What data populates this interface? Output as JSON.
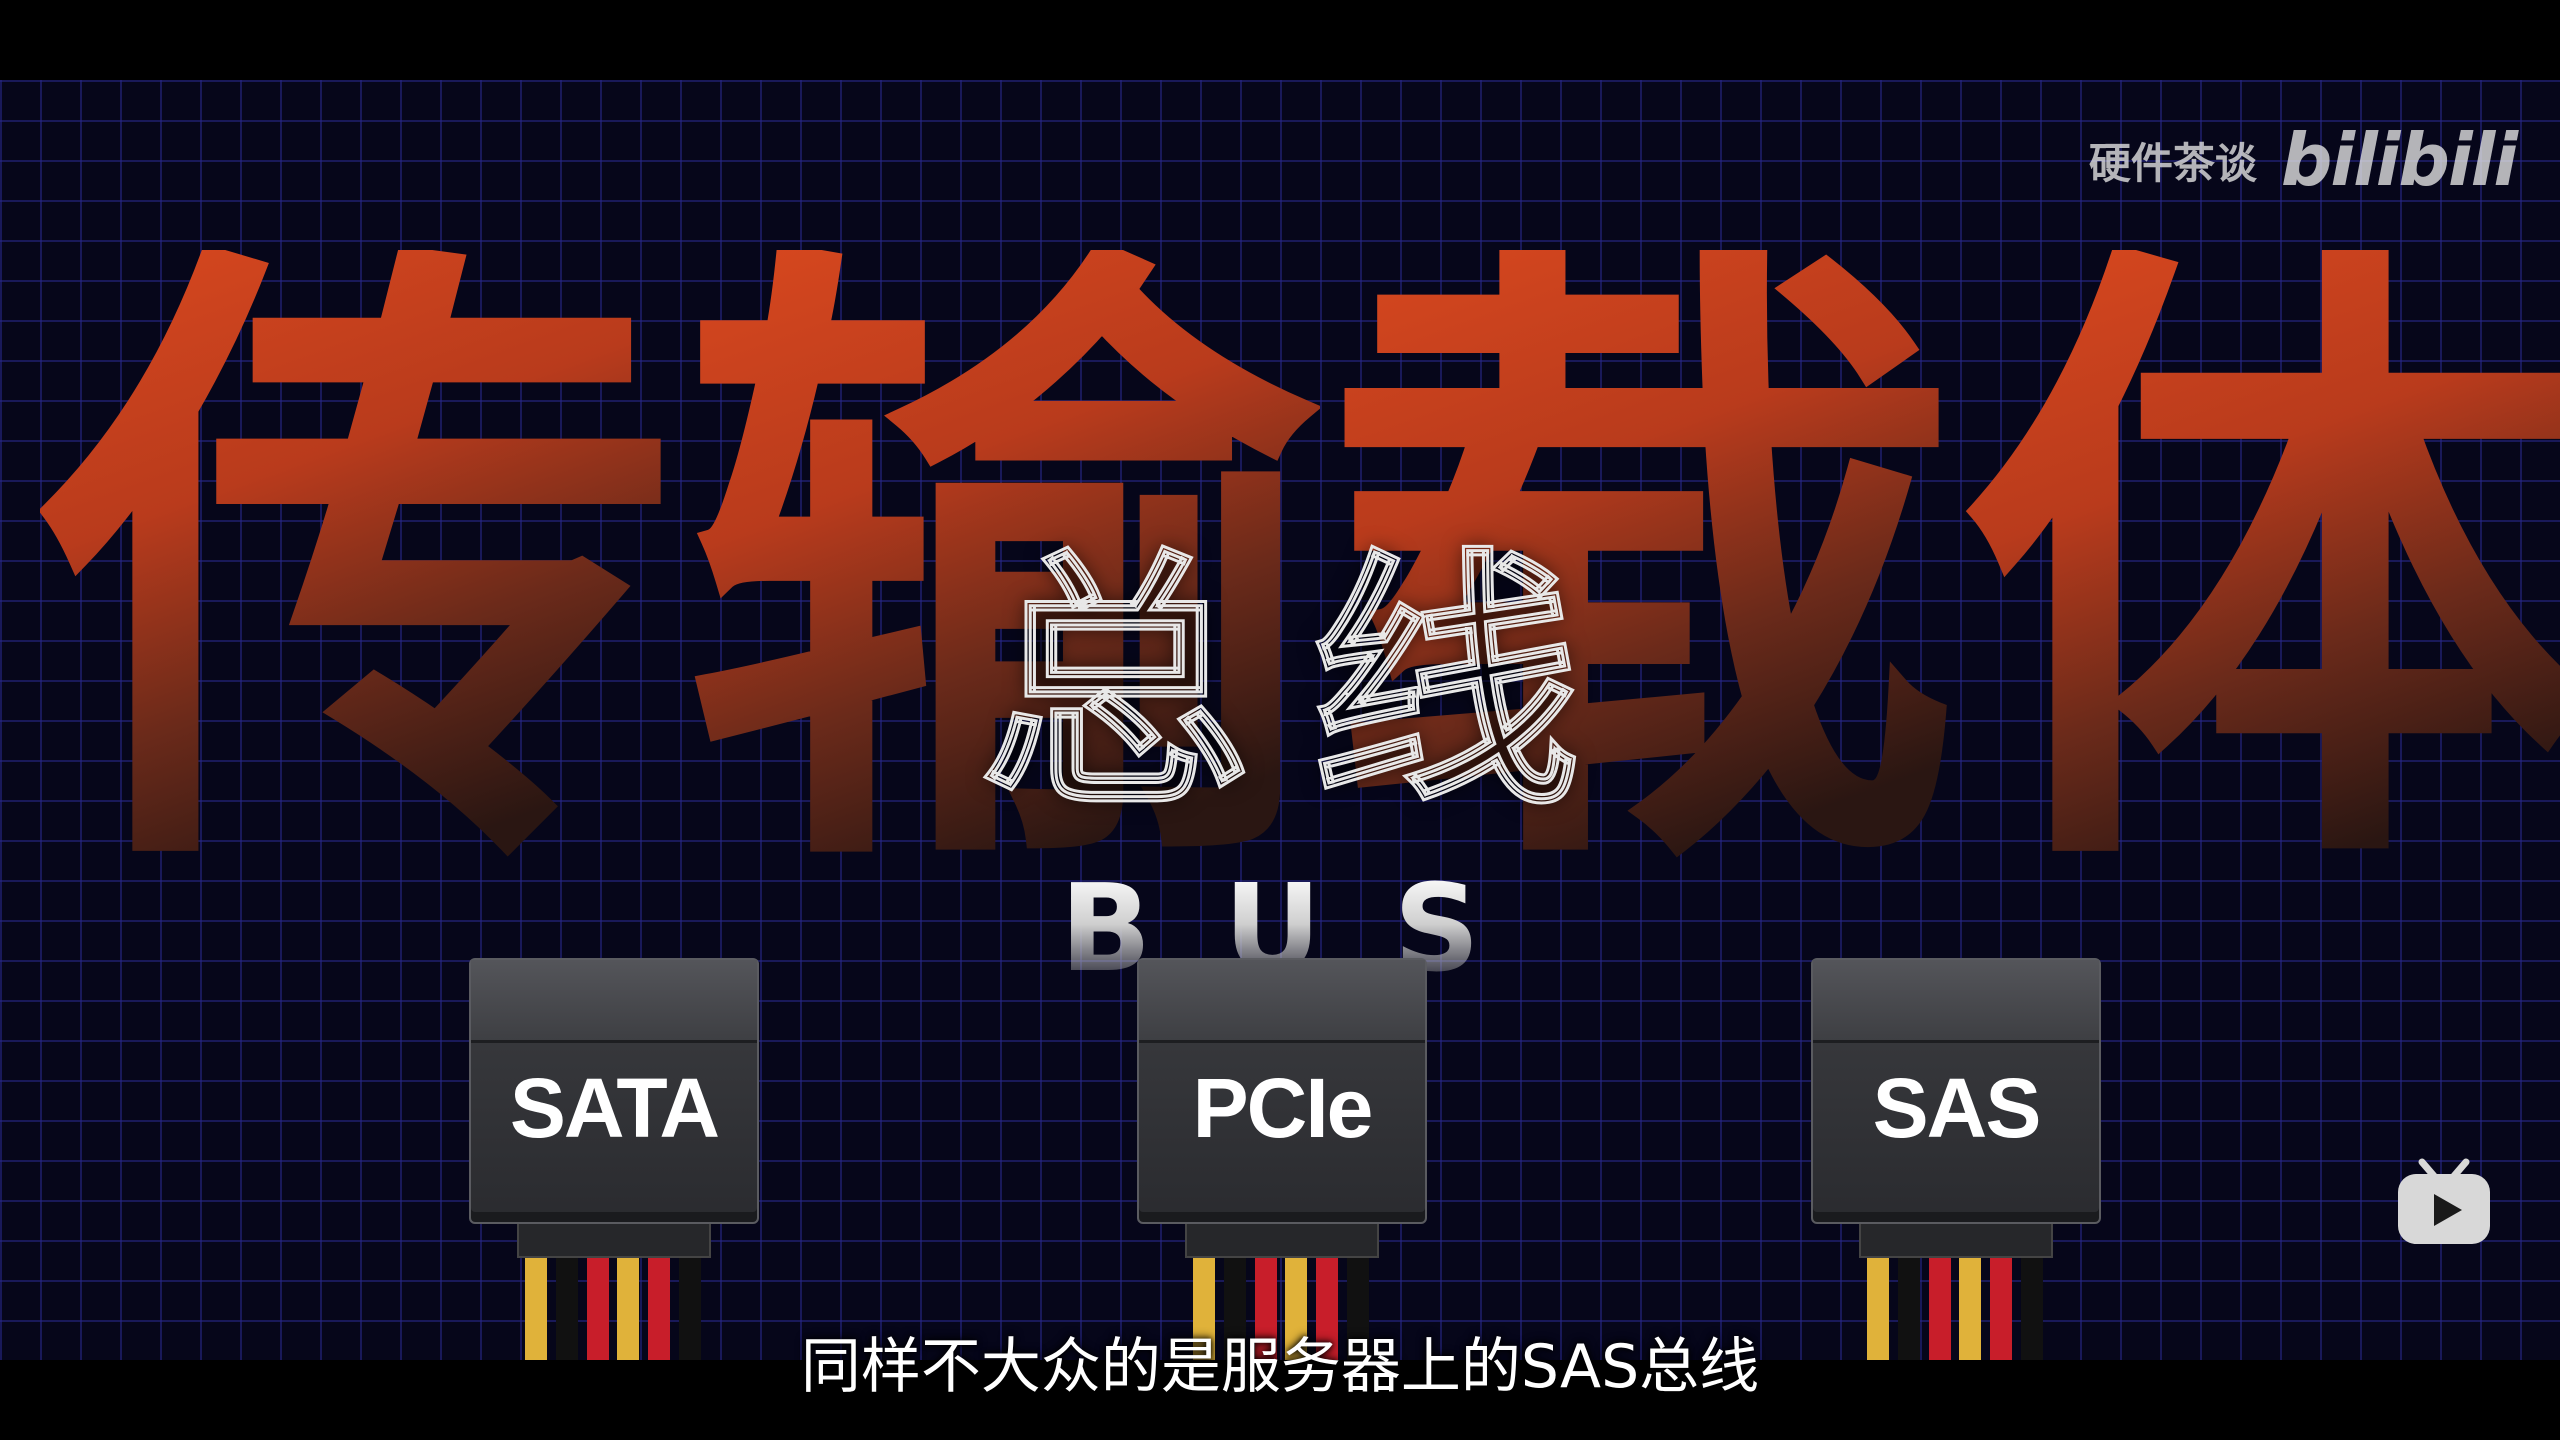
{
  "video": {
    "title_chars": [
      "传",
      "输",
      "载",
      "体"
    ],
    "overlay_chars": [
      "总",
      "线"
    ],
    "bus_letters": [
      "B",
      "U",
      "S"
    ],
    "subtitle": "同样不大众的是服务器上的SAS总线"
  },
  "watermark": {
    "channel": "硬件茶谈",
    "logo": "bilibili"
  },
  "connectors": [
    {
      "label": "SATA"
    },
    {
      "label": "PCIe"
    },
    {
      "label": "SAS"
    }
  ],
  "wire_colors": [
    "#e0b23a",
    "#111111",
    "#c81e2a",
    "#e0b23a",
    "#c81e2a",
    "#111111"
  ],
  "icons": {
    "player": "bilibili-tv-icon"
  }
}
